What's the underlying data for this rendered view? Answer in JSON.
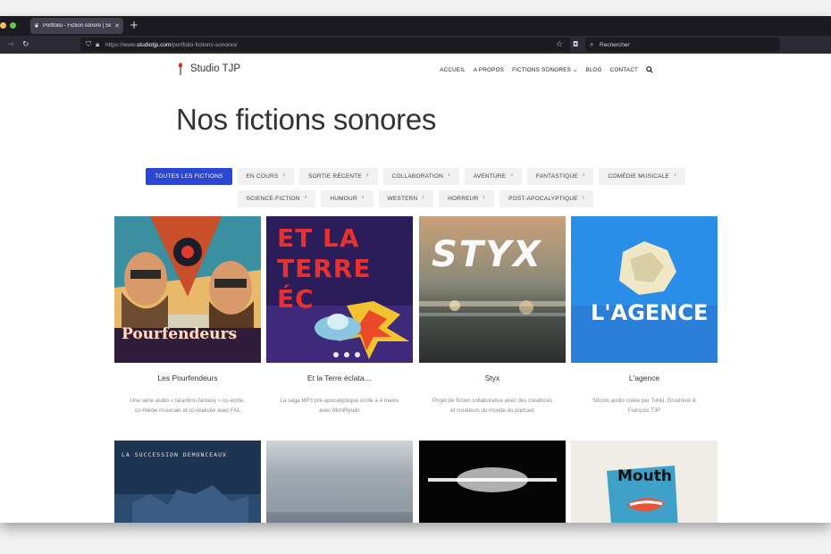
{
  "browser": {
    "tab_title": "Portfolio - Fiction sonore | Séri",
    "url_prefix": "https://www.",
    "url_domain": "studiotjp.com",
    "url_path": "/portfolio-fictions-sonores/",
    "search_placeholder": "Rechercher"
  },
  "site": {
    "logo_text": "Studio TJP",
    "menu": [
      "ACCUEIL",
      "A PROPOS",
      "FICTIONS SONORES ⌄",
      "BLOG",
      "CONTACT"
    ]
  },
  "page_title": "Nos fictions sonores",
  "filters": {
    "row1": [
      {
        "label": "TOUTES LES FICTIONS",
        "count": "",
        "active": true
      },
      {
        "label": "EN COURS",
        "count": "3"
      },
      {
        "label": "SORTIE RÉCENTE",
        "count": "3"
      },
      {
        "label": "COLLABORATION",
        "count": "4"
      },
      {
        "label": "AVENTURE",
        "count": "3"
      },
      {
        "label": "FANTASTIQUE",
        "count": "4"
      },
      {
        "label": "COMÉDIE MUSICALE",
        "count": "1"
      }
    ],
    "row2": [
      {
        "label": "SCIENCE-FICTION",
        "count": "4"
      },
      {
        "label": "HUMOUR",
        "count": "5"
      },
      {
        "label": "WESTERN",
        "count": "1"
      },
      {
        "label": "HORREUR",
        "count": "1"
      },
      {
        "label": "POST-APOCALYPTIQUE",
        "count": "1"
      }
    ]
  },
  "cards": [
    {
      "title": "Les Pourfendeurs",
      "desc": "Une série audio « tarantino-fantasy » co-écrite, co-médie musicale et co-réalisée avec FAL",
      "cover_text": "Pourfendeurs"
    },
    {
      "title": "Et la Terre éclata…",
      "desc": "La saga MP3 pré-apocalyptique écrite à 4 mains avec MimiRyudo",
      "cover_text": "ET LA TERRE ÉC"
    },
    {
      "title": "Styx",
      "desc": "Projet de fiction collaborative avec des créatrices et créateurs du monde du podcast",
      "cover_text": "STYX"
    },
    {
      "title": "L'agence",
      "desc": "Sitcom audio créée par Tuhki, Grushkov & François TJP",
      "cover_text": "L'AGENCE"
    },
    {
      "title": "",
      "desc": "",
      "cover_text": "LA SUCCESSION DEMONCEAUX"
    },
    {
      "title": "",
      "desc": "",
      "cover_text": ""
    },
    {
      "title": "",
      "desc": "",
      "cover_text": ""
    },
    {
      "title": "",
      "desc": "",
      "cover_text": "Mouth"
    }
  ],
  "colors": {
    "accent": "#2b46d2",
    "browser_dark": "#1c1b22"
  }
}
